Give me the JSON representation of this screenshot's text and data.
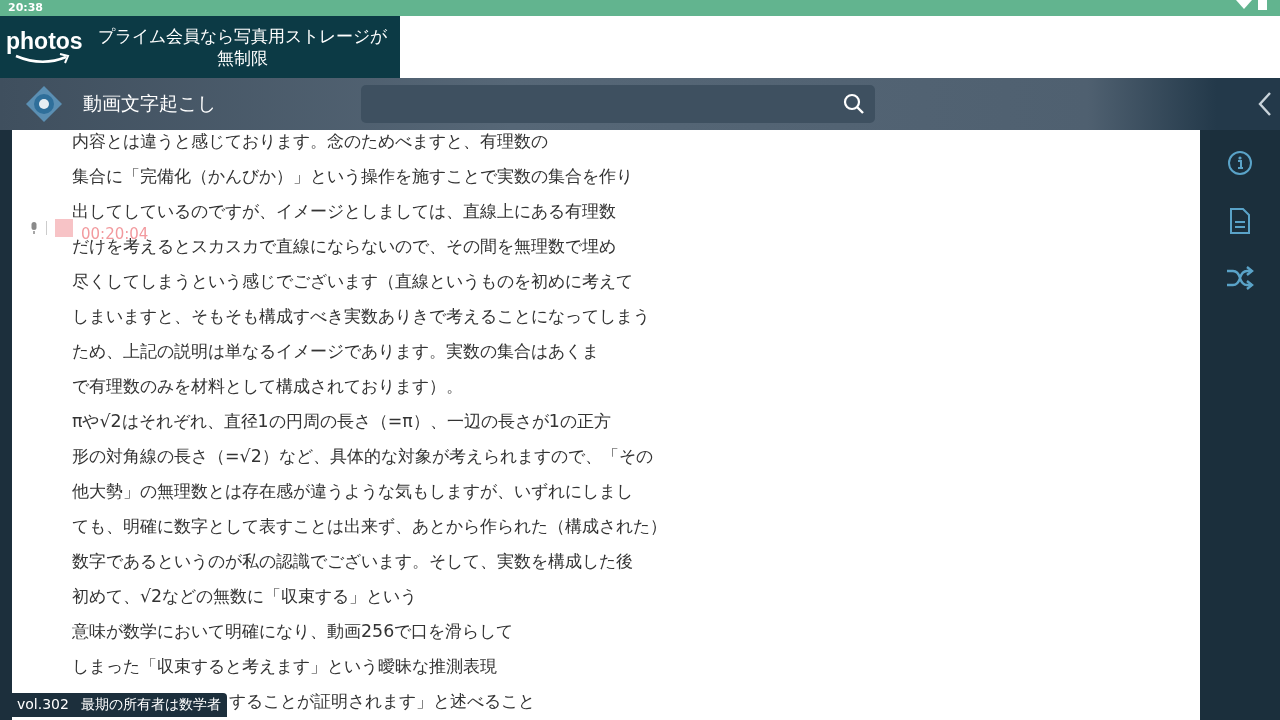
{
  "status_bar": {
    "time": "20:38"
  },
  "ad_banner": {
    "logo": "photos",
    "message": "プライム会員なら写真用ストレージが無制限"
  },
  "toolbar": {
    "title": "動画文字起こし"
  },
  "recording": {
    "time": "00:20:04"
  },
  "transcript": [
    "内容とは違うと感じております。念のためべますと、有理数の",
    "集合に「完備化（かんびか）」という操作を施すことで実数の集合を作り",
    "出してしているのですが、イメージとしましては、直線上にある有理数",
    "だけを考えるとスカスカで直線にならないので、その間を無理数で埋め",
    "尽くしてしまうという感じでございます（直線というものを初めに考えて",
    "しまいますと、そもそも構成すべき実数ありきで考えることになってしまう",
    "ため、上記の説明は単なるイメージであります。実数の集合はあくま",
    "で有理数のみを材料として構成されております）。",
    "πや√2はそれぞれ、直径1の円周の長さ（=π）、一辺の長さが1の正方",
    "形の対角線の長さ（=√2）など、具体的な対象が考えられますので、「その",
    "他大勢」の無理数とは存在感が違うような気もしますが、いずれにしまし",
    "ても、明確に数字として表すことは出来ず、あとから作られた（構成された）",
    "数字であるというのが私の認識でございます。そして、実数を構成した後",
    "初めて、√2などの無数に「収束する」という",
    "意味が数学において明確になり、動画256で口を滑らして",
    "しまった「収束すると考えます」という曖昧な推測表現"
  ],
  "transcript_tail": "することが証明されます」と述べること",
  "caption_badge": {
    "volume": "vol.302",
    "title": "最期の所有者は数学者"
  }
}
